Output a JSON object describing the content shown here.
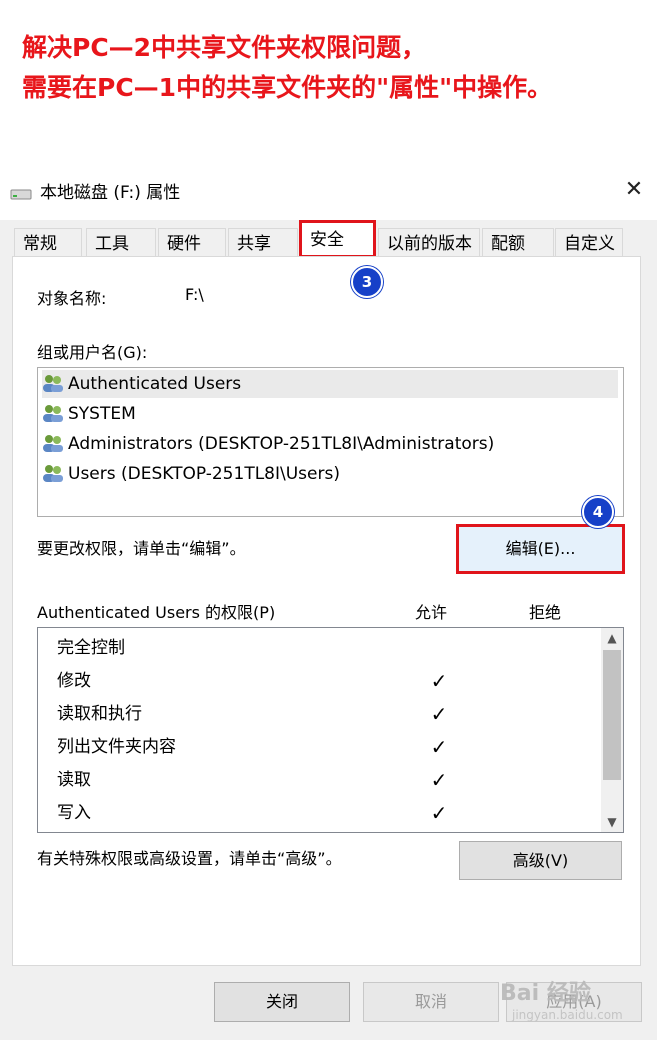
{
  "banner": {
    "line1": "解决PC—2中共享文件夹权限问题，",
    "line2": "需要在PC—1中的共享文件夹的\"属性\"中操作。"
  },
  "window": {
    "title": "本地磁盘 (F:) 属性",
    "close_glyph": "✕"
  },
  "tabs": [
    "常规",
    "工具",
    "硬件",
    "共享",
    "安全",
    "以前的版本",
    "配额",
    "自定义"
  ],
  "security": {
    "object_label": "对象名称:",
    "object_value": "F:\\",
    "group_label": "组或用户名(G):",
    "users": [
      "Authenticated Users",
      "SYSTEM",
      "Administrators (DESKTOP-251TL8I\\Administrators)",
      "Users (DESKTOP-251TL8I\\Users)"
    ],
    "edit_hint": "要更改权限，请单击“编辑”。",
    "edit_button": "编辑(E)...",
    "perm_header": "Authenticated Users 的权限(P)",
    "allow_header": "允许",
    "deny_header": "拒绝",
    "permissions": [
      {
        "name": "完全控制",
        "allow": ""
      },
      {
        "name": "修改",
        "allow": "✓"
      },
      {
        "name": "读取和执行",
        "allow": "✓"
      },
      {
        "name": "列出文件夹内容",
        "allow": "✓"
      },
      {
        "name": "读取",
        "allow": "✓"
      },
      {
        "name": "写入",
        "allow": "✓"
      }
    ],
    "advanced_hint": "有关特殊权限或高级设置，请单击“高级”。",
    "advanced_button": "高级(V)"
  },
  "footer": {
    "close": "关闭",
    "cancel": "取消",
    "apply": "应用(A)"
  },
  "badges": {
    "b3": "3",
    "b4": "4"
  },
  "watermark": {
    "main": "Bai 经验",
    "sub": "jingyan.baidu.com"
  },
  "colors": {
    "annotation_red": "#e0141b",
    "badge_blue": "#1640c8",
    "banner_red": "#e8161b"
  }
}
